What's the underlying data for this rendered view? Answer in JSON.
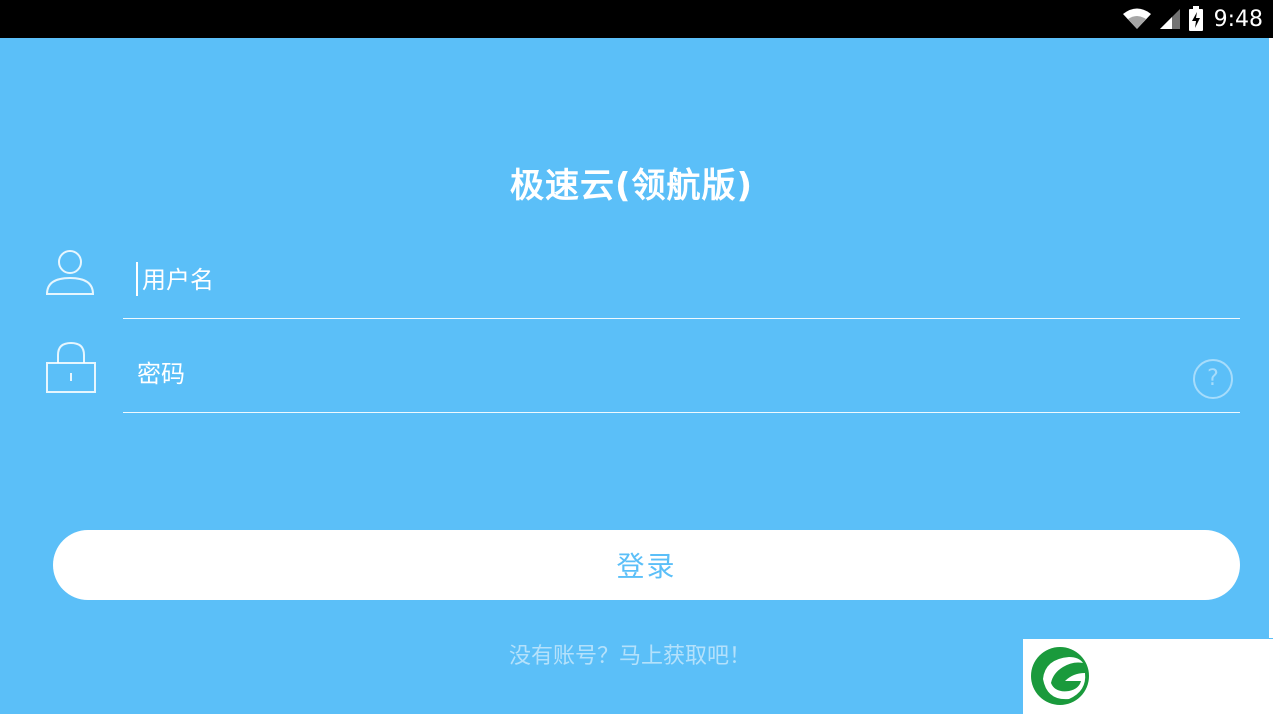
{
  "status_bar": {
    "time": "9:48",
    "icons": [
      "wifi-icon",
      "signal-icon",
      "battery-charging-icon"
    ]
  },
  "app": {
    "title": "极速云(领航版)"
  },
  "form": {
    "username_placeholder": "用户名",
    "password_placeholder": "密码",
    "help_label": "?",
    "username_icon": "user-icon",
    "password_icon": "lock-icon"
  },
  "actions": {
    "login_label": "登录",
    "register_link": "没有账号？马上获取吧！"
  },
  "colors": {
    "background": "#5bbff8",
    "button_bg": "#ffffff",
    "button_text": "#5bbff8",
    "link_text": "#b4e1fb",
    "logo_green": "#1a9a3c"
  }
}
